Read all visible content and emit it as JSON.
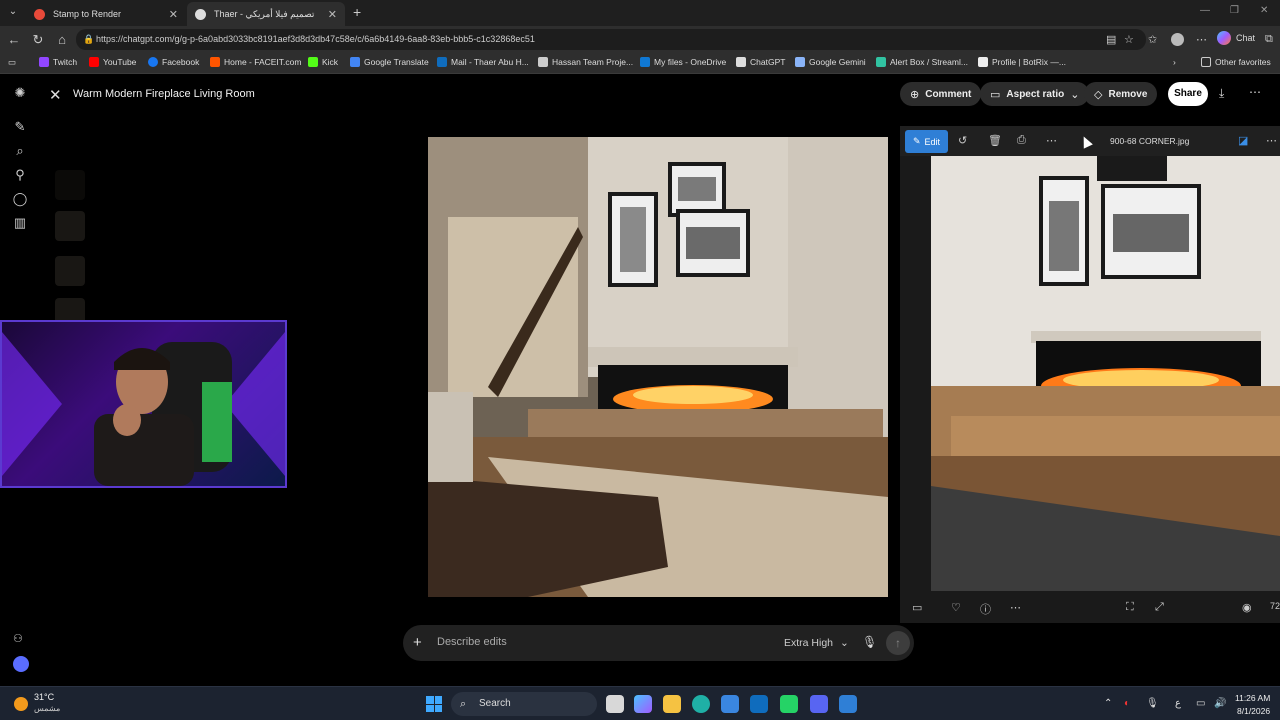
{
  "browser": {
    "tabs": [
      {
        "title": "Stamp to Render",
        "active": false
      },
      {
        "title": "Thaer - تصميم فيلا أمريكي",
        "active": true
      }
    ],
    "url": "https://chatgpt.com/g/g-p-6a0abd3033bc8191aef3d8d3db47c58e/c/6a6b4149-6aa8-83eb-bbb5-c1c32868ec51",
    "chat_label": "Chat",
    "bookmarks": [
      "Twitch",
      "YouTube",
      "Facebook",
      "Home - FACEIT.com",
      "Kick",
      "Google Translate",
      "Mail - Thaer Abu H...",
      "Hassan Team Proje...",
      "My files - OneDrive",
      "ChatGPT",
      "Google Gemini",
      "Alert Box / Streaml...",
      "Profile | BotRix —..."
    ],
    "other_favorites": "Other favorites"
  },
  "app": {
    "title": "Warm Modern Fireplace Living Room",
    "comment_label": "Comment",
    "aspect_label": "Aspect ratio",
    "remove_label": "Remove",
    "share_label": "Share"
  },
  "viewer": {
    "edit_label": "Edit",
    "filename": "900-68 CORNER.jpg",
    "zoom_partial": "72"
  },
  "composer": {
    "placeholder": "Describe edits",
    "quality": "Extra High"
  },
  "taskbar": {
    "temp": "31°C",
    "weather": "مشمس",
    "search_label": "Search",
    "time": "11:26 AM",
    "date": "8/1/2026",
    "lang": "ع"
  },
  "colors": {
    "accent_blue": "#2f7fd6",
    "app_bg": "#000000",
    "button_bg": "#2c2c2c"
  }
}
